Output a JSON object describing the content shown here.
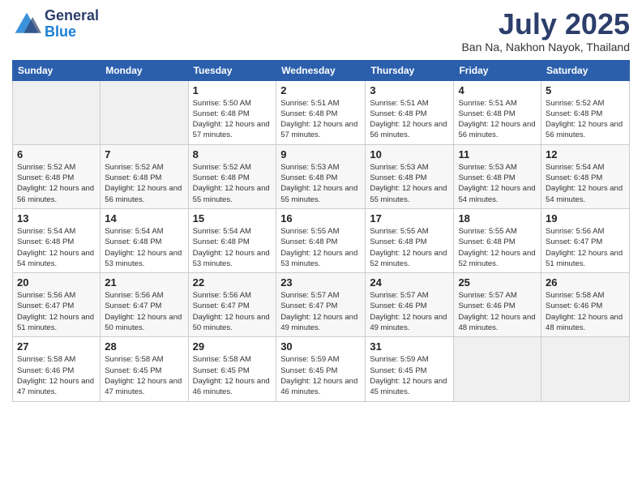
{
  "logo": {
    "general": "General",
    "blue": "Blue"
  },
  "header": {
    "month": "July 2025",
    "location": "Ban Na, Nakhon Nayok, Thailand"
  },
  "weekdays": [
    "Sunday",
    "Monday",
    "Tuesday",
    "Wednesday",
    "Thursday",
    "Friday",
    "Saturday"
  ],
  "weeks": [
    [
      {
        "day": "",
        "sunrise": "",
        "sunset": "",
        "daylight": ""
      },
      {
        "day": "",
        "sunrise": "",
        "sunset": "",
        "daylight": ""
      },
      {
        "day": "1",
        "sunrise": "Sunrise: 5:50 AM",
        "sunset": "Sunset: 6:48 PM",
        "daylight": "Daylight: 12 hours and 57 minutes."
      },
      {
        "day": "2",
        "sunrise": "Sunrise: 5:51 AM",
        "sunset": "Sunset: 6:48 PM",
        "daylight": "Daylight: 12 hours and 57 minutes."
      },
      {
        "day": "3",
        "sunrise": "Sunrise: 5:51 AM",
        "sunset": "Sunset: 6:48 PM",
        "daylight": "Daylight: 12 hours and 56 minutes."
      },
      {
        "day": "4",
        "sunrise": "Sunrise: 5:51 AM",
        "sunset": "Sunset: 6:48 PM",
        "daylight": "Daylight: 12 hours and 56 minutes."
      },
      {
        "day": "5",
        "sunrise": "Sunrise: 5:52 AM",
        "sunset": "Sunset: 6:48 PM",
        "daylight": "Daylight: 12 hours and 56 minutes."
      }
    ],
    [
      {
        "day": "6",
        "sunrise": "Sunrise: 5:52 AM",
        "sunset": "Sunset: 6:48 PM",
        "daylight": "Daylight: 12 hours and 56 minutes."
      },
      {
        "day": "7",
        "sunrise": "Sunrise: 5:52 AM",
        "sunset": "Sunset: 6:48 PM",
        "daylight": "Daylight: 12 hours and 56 minutes."
      },
      {
        "day": "8",
        "sunrise": "Sunrise: 5:52 AM",
        "sunset": "Sunset: 6:48 PM",
        "daylight": "Daylight: 12 hours and 55 minutes."
      },
      {
        "day": "9",
        "sunrise": "Sunrise: 5:53 AM",
        "sunset": "Sunset: 6:48 PM",
        "daylight": "Daylight: 12 hours and 55 minutes."
      },
      {
        "day": "10",
        "sunrise": "Sunrise: 5:53 AM",
        "sunset": "Sunset: 6:48 PM",
        "daylight": "Daylight: 12 hours and 55 minutes."
      },
      {
        "day": "11",
        "sunrise": "Sunrise: 5:53 AM",
        "sunset": "Sunset: 6:48 PM",
        "daylight": "Daylight: 12 hours and 54 minutes."
      },
      {
        "day": "12",
        "sunrise": "Sunrise: 5:54 AM",
        "sunset": "Sunset: 6:48 PM",
        "daylight": "Daylight: 12 hours and 54 minutes."
      }
    ],
    [
      {
        "day": "13",
        "sunrise": "Sunrise: 5:54 AM",
        "sunset": "Sunset: 6:48 PM",
        "daylight": "Daylight: 12 hours and 54 minutes."
      },
      {
        "day": "14",
        "sunrise": "Sunrise: 5:54 AM",
        "sunset": "Sunset: 6:48 PM",
        "daylight": "Daylight: 12 hours and 53 minutes."
      },
      {
        "day": "15",
        "sunrise": "Sunrise: 5:54 AM",
        "sunset": "Sunset: 6:48 PM",
        "daylight": "Daylight: 12 hours and 53 minutes."
      },
      {
        "day": "16",
        "sunrise": "Sunrise: 5:55 AM",
        "sunset": "Sunset: 6:48 PM",
        "daylight": "Daylight: 12 hours and 53 minutes."
      },
      {
        "day": "17",
        "sunrise": "Sunrise: 5:55 AM",
        "sunset": "Sunset: 6:48 PM",
        "daylight": "Daylight: 12 hours and 52 minutes."
      },
      {
        "day": "18",
        "sunrise": "Sunrise: 5:55 AM",
        "sunset": "Sunset: 6:48 PM",
        "daylight": "Daylight: 12 hours and 52 minutes."
      },
      {
        "day": "19",
        "sunrise": "Sunrise: 5:56 AM",
        "sunset": "Sunset: 6:47 PM",
        "daylight": "Daylight: 12 hours and 51 minutes."
      }
    ],
    [
      {
        "day": "20",
        "sunrise": "Sunrise: 5:56 AM",
        "sunset": "Sunset: 6:47 PM",
        "daylight": "Daylight: 12 hours and 51 minutes."
      },
      {
        "day": "21",
        "sunrise": "Sunrise: 5:56 AM",
        "sunset": "Sunset: 6:47 PM",
        "daylight": "Daylight: 12 hours and 50 minutes."
      },
      {
        "day": "22",
        "sunrise": "Sunrise: 5:56 AM",
        "sunset": "Sunset: 6:47 PM",
        "daylight": "Daylight: 12 hours and 50 minutes."
      },
      {
        "day": "23",
        "sunrise": "Sunrise: 5:57 AM",
        "sunset": "Sunset: 6:47 PM",
        "daylight": "Daylight: 12 hours and 49 minutes."
      },
      {
        "day": "24",
        "sunrise": "Sunrise: 5:57 AM",
        "sunset": "Sunset: 6:46 PM",
        "daylight": "Daylight: 12 hours and 49 minutes."
      },
      {
        "day": "25",
        "sunrise": "Sunrise: 5:57 AM",
        "sunset": "Sunset: 6:46 PM",
        "daylight": "Daylight: 12 hours and 48 minutes."
      },
      {
        "day": "26",
        "sunrise": "Sunrise: 5:58 AM",
        "sunset": "Sunset: 6:46 PM",
        "daylight": "Daylight: 12 hours and 48 minutes."
      }
    ],
    [
      {
        "day": "27",
        "sunrise": "Sunrise: 5:58 AM",
        "sunset": "Sunset: 6:46 PM",
        "daylight": "Daylight: 12 hours and 47 minutes."
      },
      {
        "day": "28",
        "sunrise": "Sunrise: 5:58 AM",
        "sunset": "Sunset: 6:45 PM",
        "daylight": "Daylight: 12 hours and 47 minutes."
      },
      {
        "day": "29",
        "sunrise": "Sunrise: 5:58 AM",
        "sunset": "Sunset: 6:45 PM",
        "daylight": "Daylight: 12 hours and 46 minutes."
      },
      {
        "day": "30",
        "sunrise": "Sunrise: 5:59 AM",
        "sunset": "Sunset: 6:45 PM",
        "daylight": "Daylight: 12 hours and 46 minutes."
      },
      {
        "day": "31",
        "sunrise": "Sunrise: 5:59 AM",
        "sunset": "Sunset: 6:45 PM",
        "daylight": "Daylight: 12 hours and 45 minutes."
      },
      {
        "day": "",
        "sunrise": "",
        "sunset": "",
        "daylight": ""
      },
      {
        "day": "",
        "sunrise": "",
        "sunset": "",
        "daylight": ""
      }
    ]
  ]
}
